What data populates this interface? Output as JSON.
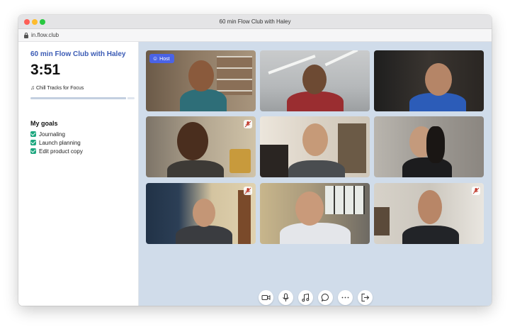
{
  "window": {
    "title": "60 min Flow Club with Haley",
    "url": "in.flow.club"
  },
  "sidebar": {
    "session_title": "60 min Flow Club with Haley",
    "timer": "3:51",
    "music": "Chill Tracks for Focus",
    "session_progress": 0.92,
    "goals_title": "My goals",
    "goals": [
      {
        "label": "Journaling",
        "checked": true
      },
      {
        "label": "Launch planning",
        "checked": true
      },
      {
        "label": "Edit product copy",
        "checked": true
      }
    ]
  },
  "video_grid": {
    "host_label": "Host",
    "tiles": [
      {
        "role": "host",
        "muted": false
      },
      {
        "role": "participant",
        "muted": false
      },
      {
        "role": "participant",
        "muted": false
      },
      {
        "role": "participant",
        "muted": true
      },
      {
        "role": "participant",
        "muted": false
      },
      {
        "role": "participant",
        "muted": false
      },
      {
        "role": "participant",
        "muted": true
      },
      {
        "role": "participant",
        "muted": false
      },
      {
        "role": "participant",
        "muted": true
      }
    ]
  },
  "controls": [
    {
      "icon": "video-camera-icon"
    },
    {
      "icon": "microphone-icon"
    },
    {
      "icon": "music-note-icon"
    },
    {
      "icon": "chat-bubble-icon"
    },
    {
      "icon": "more-dots-icon"
    },
    {
      "icon": "leave-icon"
    }
  ],
  "colors": {
    "accent": "#3b5bb5",
    "host_badge": "#4a63e6",
    "check_green": "#1ea77f",
    "grid_background": "#d0dcea"
  }
}
